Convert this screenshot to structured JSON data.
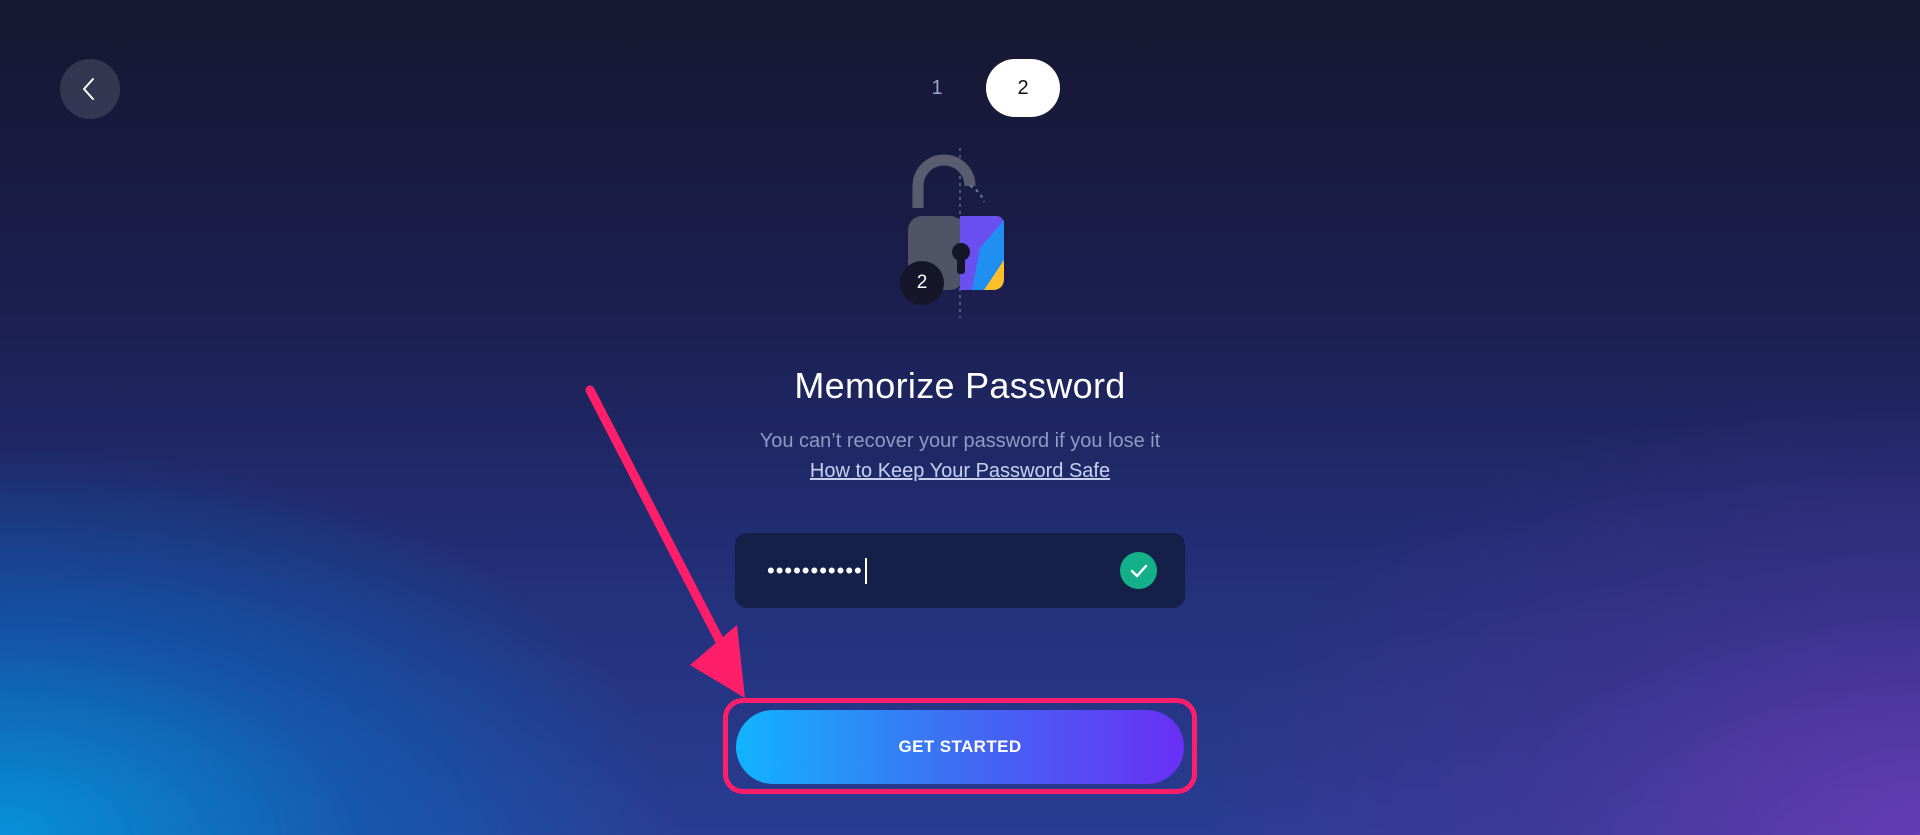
{
  "nav": {
    "back_icon": "chevron-left-icon"
  },
  "steps": [
    {
      "label": "1",
      "active": false
    },
    {
      "label": "2",
      "active": true
    }
  ],
  "illustration": {
    "icon": "padlock-icon",
    "badge": "2"
  },
  "title": "Memorize Password",
  "subtitle": "You can’t recover your password if you lose it",
  "help_link": "How to Keep Your Password Safe",
  "password": {
    "value": "•••••••••••",
    "valid_icon": "check-icon"
  },
  "cta": {
    "label": "GET STARTED"
  },
  "annotation": {
    "color": "#ff1e6a",
    "arrow_icon": "pointer-arrow-icon"
  },
  "colors": {
    "cta_gradient_start": "#12b4ff",
    "cta_gradient_end": "#6a2ff6",
    "valid_green": "#14b08a",
    "highlight": "#ff1e6a"
  }
}
